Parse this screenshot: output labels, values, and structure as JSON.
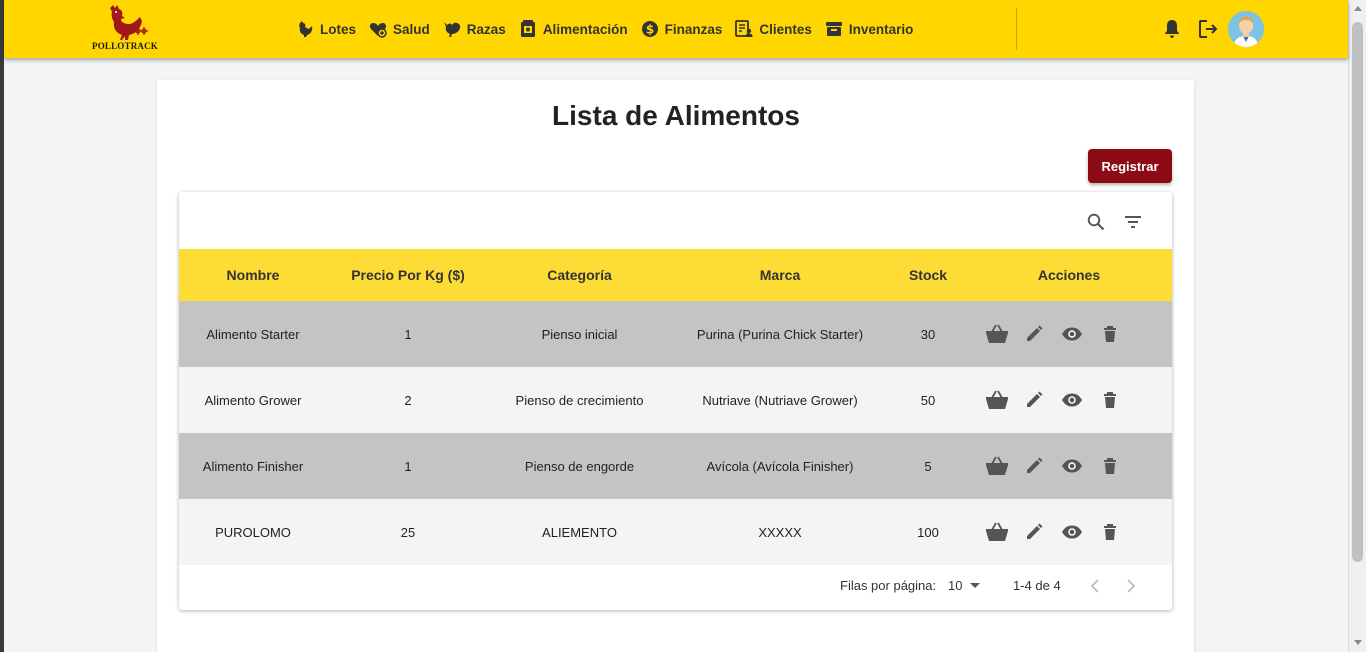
{
  "brand": {
    "name": "POLLOTRACK"
  },
  "nav": {
    "items": [
      {
        "label": "Lotes",
        "icon": "hen-icon"
      },
      {
        "label": "Salud",
        "icon": "health-heart-icon"
      },
      {
        "label": "Razas",
        "icon": "bird-icon"
      },
      {
        "label": "Alimentación",
        "icon": "feed-bag-icon"
      },
      {
        "label": "Finanzas",
        "icon": "dollar-coin-icon"
      },
      {
        "label": "Clientes",
        "icon": "client-list-icon"
      },
      {
        "label": "Inventario",
        "icon": "archive-box-icon"
      }
    ]
  },
  "page": {
    "title": "Lista de Alimentos",
    "register_label": "Registrar"
  },
  "table": {
    "columns": [
      "Nombre",
      "Precio Por Kg ($)",
      "Categoría",
      "Marca",
      "Stock",
      "Acciones"
    ],
    "rows": [
      {
        "nombre": "Alimento Starter",
        "precio": "1",
        "categoria": "Pienso inicial",
        "marca": "Purina (Purina Chick Starter)",
        "stock": "30"
      },
      {
        "nombre": "Alimento Grower",
        "precio": "2",
        "categoria": "Pienso de crecimiento",
        "marca": "Nutriave (Nutriave Grower)",
        "stock": "50"
      },
      {
        "nombre": "Alimento Finisher",
        "precio": "1",
        "categoria": "Pienso de engorde",
        "marca": "Avícola (Avícola Finisher)",
        "stock": "5"
      },
      {
        "nombre": "PUROLOMO",
        "precio": "25",
        "categoria": "ALIEMENTO",
        "marca": "XXXXX",
        "stock": "100"
      }
    ]
  },
  "pagination": {
    "rows_per_page_label": "Filas por página:",
    "rows_per_page": "10",
    "range": "1-4 de 4"
  },
  "colors": {
    "navbar": "#ffd600",
    "header_row": "#fddc35",
    "primary_button": "#8b0a14",
    "row_dark": "#c4c4c4",
    "row_light": "#f4f4f4"
  }
}
